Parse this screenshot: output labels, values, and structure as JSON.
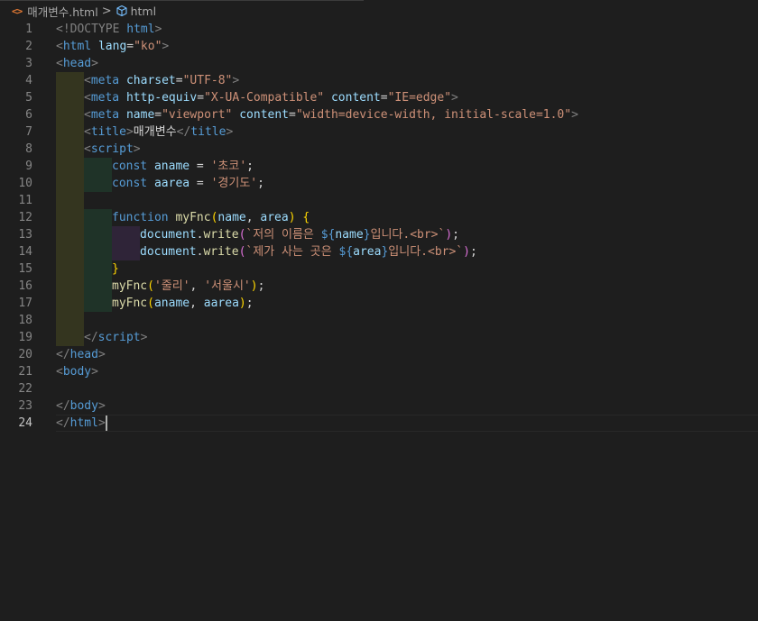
{
  "colors": {
    "background": "#1e1e1e",
    "punctuation": "#808080",
    "tag": "#569cd6",
    "attribute": "#9cdcfe",
    "string": "#ce9178",
    "text": "#d4d4d4",
    "keyword": "#569cd6",
    "function": "#dcdcaa",
    "bracket1": "#ffd700",
    "bracket2": "#da70d6",
    "bracket3": "#179fff",
    "variable": "#9cdcfe"
  },
  "breadcrumb": {
    "file_icon": "<>",
    "file_name": "매개변수.html",
    "separator": ">",
    "element_icon": "cube-icon",
    "element_name": "html"
  },
  "editor": {
    "active_line": 24,
    "lines": [
      {
        "n": "1",
        "indent": 0,
        "tokens": [
          [
            "<!DOCTYPE ",
            "punctuation"
          ],
          [
            "html",
            "tag"
          ],
          [
            ">",
            "punctuation"
          ]
        ]
      },
      {
        "n": "2",
        "indent": 0,
        "tokens": [
          [
            "<",
            "punctuation"
          ],
          [
            "html",
            "tag"
          ],
          [
            " ",
            "text"
          ],
          [
            "lang",
            "attribute"
          ],
          [
            "=",
            "text"
          ],
          [
            "\"ko\"",
            "string"
          ],
          [
            ">",
            "punctuation"
          ]
        ]
      },
      {
        "n": "3",
        "indent": 0,
        "tokens": [
          [
            "<",
            "punctuation"
          ],
          [
            "head",
            "tag"
          ],
          [
            ">",
            "punctuation"
          ]
        ]
      },
      {
        "n": "4",
        "indent": 1,
        "tokens": [
          [
            "<",
            "punctuation"
          ],
          [
            "meta",
            "tag"
          ],
          [
            " ",
            "text"
          ],
          [
            "charset",
            "attribute"
          ],
          [
            "=",
            "text"
          ],
          [
            "\"UTF-8\"",
            "string"
          ],
          [
            ">",
            "punctuation"
          ]
        ]
      },
      {
        "n": "5",
        "indent": 1,
        "tokens": [
          [
            "<",
            "punctuation"
          ],
          [
            "meta",
            "tag"
          ],
          [
            " ",
            "text"
          ],
          [
            "http-equiv",
            "attribute"
          ],
          [
            "=",
            "text"
          ],
          [
            "\"X-UA-Compatible\"",
            "string"
          ],
          [
            " ",
            "text"
          ],
          [
            "content",
            "attribute"
          ],
          [
            "=",
            "text"
          ],
          [
            "\"IE=edge\"",
            "string"
          ],
          [
            ">",
            "punctuation"
          ]
        ]
      },
      {
        "n": "6",
        "indent": 1,
        "tokens": [
          [
            "<",
            "punctuation"
          ],
          [
            "meta",
            "tag"
          ],
          [
            " ",
            "text"
          ],
          [
            "name",
            "attribute"
          ],
          [
            "=",
            "text"
          ],
          [
            "\"viewport\"",
            "string"
          ],
          [
            " ",
            "text"
          ],
          [
            "content",
            "attribute"
          ],
          [
            "=",
            "text"
          ],
          [
            "\"width=device-width, initial-scale=1.0\"",
            "string"
          ],
          [
            ">",
            "punctuation"
          ]
        ]
      },
      {
        "n": "7",
        "indent": 1,
        "tokens": [
          [
            "<",
            "punctuation"
          ],
          [
            "title",
            "tag"
          ],
          [
            ">",
            "punctuation"
          ],
          [
            "매개변수",
            "text"
          ],
          [
            "</",
            "punctuation"
          ],
          [
            "title",
            "tag"
          ],
          [
            ">",
            "punctuation"
          ]
        ]
      },
      {
        "n": "8",
        "indent": 1,
        "tokens": [
          [
            "<",
            "punctuation"
          ],
          [
            "script",
            "tag"
          ],
          [
            ">",
            "punctuation"
          ]
        ]
      },
      {
        "n": "9",
        "indent": 2,
        "tokens": [
          [
            "const",
            "keyword"
          ],
          [
            " ",
            "text"
          ],
          [
            "aname",
            "variable"
          ],
          [
            " = ",
            "text"
          ],
          [
            "'초코'",
            "string"
          ],
          [
            ";",
            "text"
          ]
        ]
      },
      {
        "n": "10",
        "indent": 2,
        "tokens": [
          [
            "const",
            "keyword"
          ],
          [
            " ",
            "text"
          ],
          [
            "aarea",
            "variable"
          ],
          [
            " = ",
            "text"
          ],
          [
            "'경기도'",
            "string"
          ],
          [
            ";",
            "text"
          ]
        ]
      },
      {
        "n": "11",
        "indent": 1,
        "tokens": []
      },
      {
        "n": "12",
        "indent": 2,
        "tokens": [
          [
            "function",
            "keyword"
          ],
          [
            " ",
            "text"
          ],
          [
            "myFnc",
            "function"
          ],
          [
            "(",
            "bracket1"
          ],
          [
            "name",
            "variable"
          ],
          [
            ", ",
            "text"
          ],
          [
            "area",
            "variable"
          ],
          [
            ")",
            "bracket1"
          ],
          [
            " ",
            "text"
          ],
          [
            "{",
            "bracket1"
          ]
        ]
      },
      {
        "n": "13",
        "indent": 3,
        "tokens": [
          [
            "document",
            "variable"
          ],
          [
            ".",
            "text"
          ],
          [
            "write",
            "function"
          ],
          [
            "(",
            "bracket2"
          ],
          [
            "`저의 이름은 ",
            "string"
          ],
          [
            "${",
            "keyword"
          ],
          [
            "name",
            "variable"
          ],
          [
            "}",
            "keyword"
          ],
          [
            "입니다.<br>`",
            "string"
          ],
          [
            ")",
            "bracket2"
          ],
          [
            ";",
            "text"
          ]
        ]
      },
      {
        "n": "14",
        "indent": 3,
        "tokens": [
          [
            "document",
            "variable"
          ],
          [
            ".",
            "text"
          ],
          [
            "write",
            "function"
          ],
          [
            "(",
            "bracket2"
          ],
          [
            "`제가 사는 곳은 ",
            "string"
          ],
          [
            "${",
            "keyword"
          ],
          [
            "area",
            "variable"
          ],
          [
            "}",
            "keyword"
          ],
          [
            "입니다.<br>`",
            "string"
          ],
          [
            ")",
            "bracket2"
          ],
          [
            ";",
            "text"
          ]
        ]
      },
      {
        "n": "15",
        "indent": 2,
        "tokens": [
          [
            "}",
            "bracket1"
          ]
        ]
      },
      {
        "n": "16",
        "indent": 2,
        "tokens": [
          [
            "myFnc",
            "function"
          ],
          [
            "(",
            "bracket1"
          ],
          [
            "'줄리'",
            "string"
          ],
          [
            ", ",
            "text"
          ],
          [
            "'서울시'",
            "string"
          ],
          [
            ")",
            "bracket1"
          ],
          [
            ";",
            "text"
          ]
        ]
      },
      {
        "n": "17",
        "indent": 2,
        "tokens": [
          [
            "myFnc",
            "function"
          ],
          [
            "(",
            "bracket1"
          ],
          [
            "aname",
            "variable"
          ],
          [
            ", ",
            "text"
          ],
          [
            "aarea",
            "variable"
          ],
          [
            ")",
            "bracket1"
          ],
          [
            ";",
            "text"
          ]
        ]
      },
      {
        "n": "18",
        "indent": 1,
        "tokens": []
      },
      {
        "n": "19",
        "indent": 1,
        "tokens": [
          [
            "</",
            "punctuation"
          ],
          [
            "script",
            "tag"
          ],
          [
            ">",
            "punctuation"
          ]
        ]
      },
      {
        "n": "20",
        "indent": 0,
        "tokens": [
          [
            "</",
            "punctuation"
          ],
          [
            "head",
            "tag"
          ],
          [
            ">",
            "punctuation"
          ]
        ]
      },
      {
        "n": "21",
        "indent": 0,
        "tokens": [
          [
            "<",
            "punctuation"
          ],
          [
            "body",
            "tag"
          ],
          [
            ">",
            "punctuation"
          ]
        ]
      },
      {
        "n": "22",
        "indent": 0,
        "tokens": []
      },
      {
        "n": "23",
        "indent": 0,
        "tokens": [
          [
            "</",
            "punctuation"
          ],
          [
            "body",
            "tag"
          ],
          [
            ">",
            "punctuation"
          ]
        ]
      },
      {
        "n": "24",
        "indent": 0,
        "tokens": [
          [
            "</",
            "punctuation"
          ],
          [
            "html",
            "tag"
          ],
          [
            ">",
            "punctuation"
          ]
        ]
      }
    ]
  }
}
